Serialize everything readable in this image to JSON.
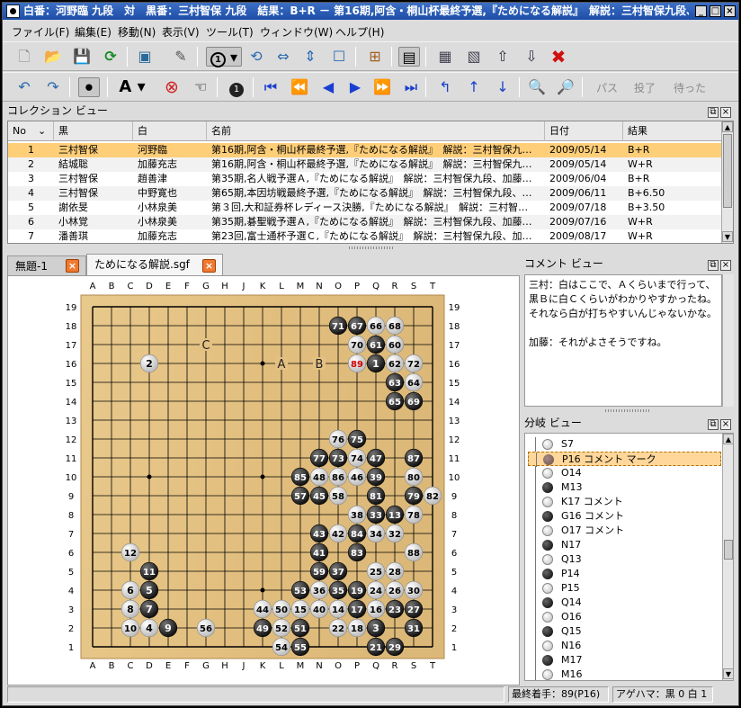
{
  "window": {
    "title": "白番：河野臨 九段　対　黒番：三村智保 九段　結果：B+R － 第16期,阿含・桐山杯最終予選,『ためになる解説』　解説：三村智保九段、加"
  },
  "menu": [
    "ファイル(F)",
    "編集(E)",
    "移動(N)",
    "表示(V)",
    "ツール(T)",
    "ウィンドウ(W)",
    "ヘルプ(H)"
  ],
  "toolbar2_text": {
    "pass": "パス",
    "resign": "投了",
    "undo": "待った"
  },
  "collection": {
    "title": "コレクション ビュー",
    "headers": [
      "No",
      "黒",
      "白",
      "名前",
      "日付",
      "結果"
    ],
    "rows": [
      [
        "1",
        "三村智保",
        "河野臨",
        "第16期,阿含・桐山杯最終予選,『ためになる解説』　解説：三村智保九…",
        "2009/05/14",
        "B+R"
      ],
      [
        "2",
        "結城聡",
        "加藤充志",
        "第16期,阿含・桐山杯最終予選,『ためになる解説』　解説：三村智保九…",
        "2009/05/14",
        "W+R"
      ],
      [
        "3",
        "三村智保",
        "趙善津",
        "第35期,名人戦予選Ａ,『ためになる解説』　解説：三村智保九段、加藤…",
        "2009/06/04",
        "B+R"
      ],
      [
        "4",
        "三村智保",
        "中野寛也",
        "第65期,本因坊戦最終予選,『ためになる解説』　解説：三村智保九段、…",
        "2009/06/11",
        "B+6.50"
      ],
      [
        "5",
        "謝依旻",
        "小林泉美",
        "第３回,大和証券杯レディース決勝,『ためになる解説』　解説：三村智…",
        "2009/07/18",
        "B+3.50"
      ],
      [
        "6",
        "小林覚",
        "小林泉美",
        "第35期,碁聖戦予選Ａ,『ためになる解説』　解説：三村智保九段、加藤…",
        "2009/07/16",
        "W+R"
      ],
      [
        "7",
        "潘善琪",
        "加藤充志",
        "第23回,富士通杯予選Ｃ,『ためになる解説』　解説：三村智保九段、加…",
        "2009/08/17",
        "W+R"
      ]
    ]
  },
  "tabs": [
    {
      "label": "無題-1"
    },
    {
      "label": "ためになる解説.sgf"
    }
  ],
  "board": {
    "cols": [
      "A",
      "B",
      "C",
      "D",
      "E",
      "F",
      "G",
      "H",
      "J",
      "K",
      "L",
      "M",
      "N",
      "O",
      "P",
      "Q",
      "R",
      "S",
      "T"
    ],
    "rows": [
      "19",
      "18",
      "17",
      "16",
      "15",
      "14",
      "13",
      "12",
      "11",
      "10",
      "9",
      "8",
      "7",
      "6",
      "5",
      "4",
      "3",
      "2",
      "1"
    ],
    "letters": [
      {
        "pt": "G17",
        "t": "C"
      },
      {
        "pt": "L16",
        "t": "A"
      },
      {
        "pt": "N16",
        "t": "B"
      }
    ],
    "marks": [
      "K16"
    ],
    "stones": [
      [
        "O18",
        "b",
        "71"
      ],
      [
        "P18",
        "b",
        "67"
      ],
      [
        "Q18",
        "w",
        "66"
      ],
      [
        "R18",
        "w",
        "68"
      ],
      [
        "P17",
        "w",
        "70"
      ],
      [
        "Q17",
        "b",
        "61"
      ],
      [
        "R17",
        "w",
        "60"
      ],
      [
        "D16",
        "w",
        "2"
      ],
      [
        "P16",
        "w",
        "89"
      ],
      [
        "Q16",
        "b",
        "1"
      ],
      [
        "R16",
        "w",
        "62"
      ],
      [
        "S16",
        "w",
        "72"
      ],
      [
        "R15",
        "b",
        "63"
      ],
      [
        "S15",
        "w",
        "64"
      ],
      [
        "R14",
        "b",
        "65"
      ],
      [
        "S14",
        "b",
        "69"
      ],
      [
        "O12",
        "w",
        "76"
      ],
      [
        "P12",
        "b",
        "75"
      ],
      [
        "N11",
        "b",
        "77"
      ],
      [
        "O11",
        "b",
        "73"
      ],
      [
        "P11",
        "w",
        "74"
      ],
      [
        "Q11",
        "b",
        "47"
      ],
      [
        "S11",
        "b",
        "87"
      ],
      [
        "M10",
        "b",
        "85"
      ],
      [
        "N10",
        "w",
        "48"
      ],
      [
        "O10",
        "w",
        "86"
      ],
      [
        "P10",
        "w",
        "46"
      ],
      [
        "Q10",
        "b",
        "39"
      ],
      [
        "S10",
        "w",
        "80"
      ],
      [
        "M9",
        "b",
        "57"
      ],
      [
        "N9",
        "b",
        "45"
      ],
      [
        "O9",
        "w",
        "58"
      ],
      [
        "Q9",
        "b",
        "81"
      ],
      [
        "S9",
        "b",
        "79"
      ],
      [
        "T9",
        "w",
        "82"
      ],
      [
        "P8",
        "w",
        "38"
      ],
      [
        "Q8",
        "b",
        "33"
      ],
      [
        "R8",
        "b",
        "13"
      ],
      [
        "S8",
        "w",
        "78"
      ],
      [
        "N7",
        "b",
        "43"
      ],
      [
        "O7",
        "w",
        "42"
      ],
      [
        "P7",
        "b",
        "84"
      ],
      [
        "Q7",
        "w",
        "34"
      ],
      [
        "R7",
        "w",
        "32"
      ],
      [
        "C6",
        "w",
        "12"
      ],
      [
        "N6",
        "b",
        "41"
      ],
      [
        "P6",
        "b",
        "83"
      ],
      [
        "S6",
        "w",
        "88"
      ],
      [
        "D5",
        "b",
        "11"
      ],
      [
        "N5",
        "b",
        "59"
      ],
      [
        "O5",
        "b",
        "37"
      ],
      [
        "Q5",
        "w",
        "25"
      ],
      [
        "R5",
        "w",
        "28"
      ],
      [
        "C4",
        "w",
        "6"
      ],
      [
        "D4",
        "b",
        "5"
      ],
      [
        "M4",
        "b",
        "53"
      ],
      [
        "N4",
        "w",
        "36"
      ],
      [
        "O4",
        "b",
        "35"
      ],
      [
        "P4",
        "b",
        "19"
      ],
      [
        "Q4",
        "w",
        "24"
      ],
      [
        "R4",
        "w",
        "26"
      ],
      [
        "S4",
        "w",
        "30"
      ],
      [
        "C3",
        "w",
        "8"
      ],
      [
        "D3",
        "b",
        "7"
      ],
      [
        "K3",
        "w",
        "44"
      ],
      [
        "L3",
        "w",
        "50"
      ],
      [
        "M3",
        "w",
        "15"
      ],
      [
        "N3",
        "w",
        "40"
      ],
      [
        "O3",
        "w",
        "14"
      ],
      [
        "P3",
        "b",
        "17"
      ],
      [
        "Q3",
        "w",
        "16"
      ],
      [
        "R3",
        "b",
        "23"
      ],
      [
        "S3",
        "b",
        "27"
      ],
      [
        "C2",
        "w",
        "10"
      ],
      [
        "D2",
        "w",
        "4"
      ],
      [
        "E2",
        "b",
        "9"
      ],
      [
        "G2",
        "w",
        "56"
      ],
      [
        "K2",
        "b",
        "49"
      ],
      [
        "L2",
        "w",
        "52"
      ],
      [
        "M2",
        "b",
        "51"
      ],
      [
        "O2",
        "w",
        "22"
      ],
      [
        "P2",
        "w",
        "18"
      ],
      [
        "Q2",
        "b",
        "3"
      ],
      [
        "S2",
        "b",
        "31"
      ],
      [
        "L1",
        "w",
        "54"
      ],
      [
        "M1",
        "b",
        "55"
      ],
      [
        "Q1",
        "b",
        "21"
      ],
      [
        "R1",
        "b",
        "29"
      ]
    ],
    "last": "P16"
  },
  "comment": {
    "title": "コメント ビュー",
    "text": "三村：白はここで、Ａくらいまで行って、黒Ｂに白Ｃくらいがわかりやすかったね。それなら白が打ちやすいんじゃないかな。\n\n加藤：それがよさそうですね。"
  },
  "variations": {
    "title": "分岐 ビュー",
    "items": [
      {
        "c": "w",
        "t": "S7"
      },
      {
        "c": "m",
        "t": "P16 コメント マーク",
        "sel": true
      },
      {
        "c": "w",
        "t": "O14"
      },
      {
        "c": "b",
        "t": "M13"
      },
      {
        "c": "w",
        "t": "K17 コメント"
      },
      {
        "c": "b",
        "t": "G16 コメント"
      },
      {
        "c": "w",
        "t": "O17 コメント"
      },
      {
        "c": "b",
        "t": "N17"
      },
      {
        "c": "w",
        "t": "Q13"
      },
      {
        "c": "b",
        "t": "P14"
      },
      {
        "c": "w",
        "t": "P15"
      },
      {
        "c": "b",
        "t": "Q14"
      },
      {
        "c": "w",
        "t": "O16"
      },
      {
        "c": "b",
        "t": "Q15"
      },
      {
        "c": "w",
        "t": "N16"
      },
      {
        "c": "b",
        "t": "M17"
      },
      {
        "c": "w",
        "t": "M16"
      }
    ]
  },
  "status": {
    "last_move": "最終着手：89(P16)",
    "captures": "アゲハマ：黒 0 白 1"
  }
}
